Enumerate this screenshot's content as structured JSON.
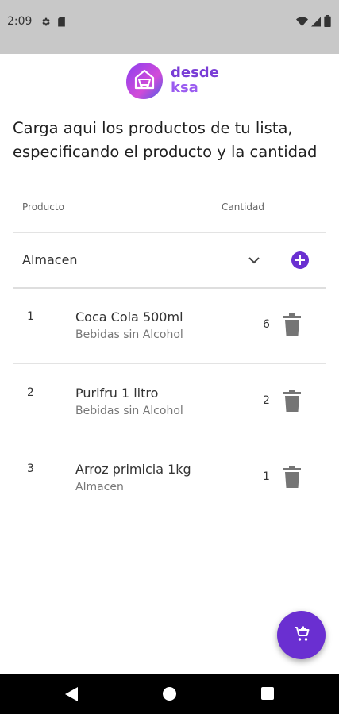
{
  "status_bar": {
    "time": "2:09",
    "left_icons": [
      "settings-icon",
      "sd-card-icon"
    ],
    "right_icons": [
      "wifi-icon",
      "signal-icon",
      "battery-icon"
    ]
  },
  "logo": {
    "line1": "desde",
    "line2": "ksa"
  },
  "intro": {
    "text": "Carga aqui los productos de tu lista, especificando el producto y la cantidad"
  },
  "columns": {
    "product": "Producto",
    "quantity": "Cantidad"
  },
  "category_select": {
    "value": "Almacen",
    "icon": "chevron-down-icon"
  },
  "add_button": {
    "icon": "add-circle-icon"
  },
  "items": [
    {
      "index": "1",
      "name": "Coca Cola 500ml",
      "category": "Bebidas sin Alcohol",
      "quantity": "6"
    },
    {
      "index": "2",
      "name": "Purifru 1 litro",
      "category": "Bebidas sin Alcohol",
      "quantity": "2"
    },
    {
      "index": "3",
      "name": "Arroz primicia 1kg",
      "category": "Almacen",
      "quantity": "1"
    }
  ],
  "fab": {
    "icon": "add-to-cart-icon"
  },
  "colors": {
    "accent": "#6a2fd1",
    "status_bar": "#c8c8c8",
    "trash": "#757575"
  }
}
